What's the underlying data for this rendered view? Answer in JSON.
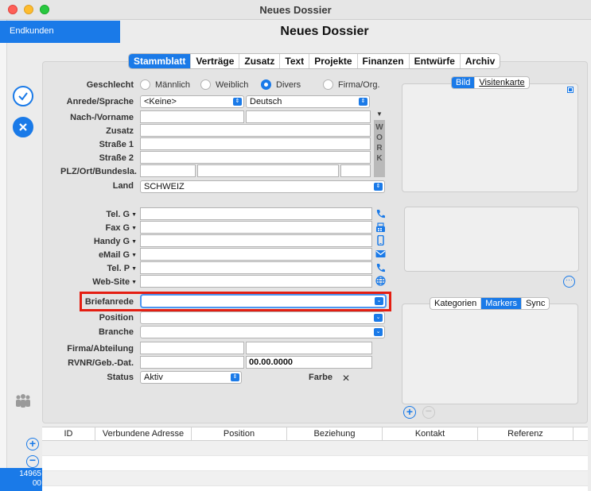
{
  "window": {
    "title": "Neues Dossier"
  },
  "sidebar": {
    "customer_tab": "Endkunden",
    "record_id": "14965\n00"
  },
  "header": {
    "title": "Neues Dossier"
  },
  "tabs": [
    {
      "label": "Stammblatt",
      "active": true
    },
    {
      "label": "Verträge"
    },
    {
      "label": "Zusatz"
    },
    {
      "label": "Text"
    },
    {
      "label": "Projekte"
    },
    {
      "label": "Finanzen"
    },
    {
      "label": "Entwürfe"
    },
    {
      "label": "Archiv"
    }
  ],
  "form": {
    "geschlecht_label": "Geschlecht",
    "gender_options": [
      "Männlich",
      "Weiblich",
      "Divers",
      "Firma/Org."
    ],
    "gender_selected": "Divers",
    "anrede_label": "Anrede/Sprache",
    "anrede_value": "<Keine>",
    "sprache_value": "Deutsch",
    "name_label": "Nach-/Vorname",
    "zusatz_label": "Zusatz",
    "strasse1_label": "Straße 1",
    "strasse2_label": "Straße 2",
    "plz_label": "PLZ/Ort/Bundesla.",
    "land_label": "Land",
    "land_value": "SCHWEIZ",
    "work_letters": [
      "W",
      "O",
      "R",
      "K"
    ],
    "tel_g_label": "Tel. G",
    "fax_g_label": "Fax G",
    "handy_g_label": "Handy G",
    "email_g_label": "eMail G",
    "tel_p_label": "Tel. P",
    "website_label": "Web-Site",
    "briefanrede_label": "Briefanrede",
    "position_label": "Position",
    "branche_label": "Branche",
    "firma_label": "Firma/Abteilung",
    "rvnr_label": "RVNR/Geb.-Dat.",
    "geb_dat_value": "00.00.0000",
    "status_label": "Status",
    "status_value": "Aktiv",
    "farbe_label": "Farbe",
    "farbe_clear": "✕"
  },
  "image_panel": {
    "tab_bild": "Bild",
    "tab_visitenkarte": "Visitenkarte"
  },
  "marker_panel": {
    "tabs": [
      "Kategorien",
      "Markers",
      "Sync"
    ],
    "active": "Markers"
  },
  "table": {
    "columns": [
      "ID",
      "Verbundene Adresse",
      "Position",
      "Beziehung",
      "Kontakt",
      "Referenz"
    ]
  },
  "colors": {
    "accent": "#1a7ae8",
    "highlight": "#e41e12"
  }
}
